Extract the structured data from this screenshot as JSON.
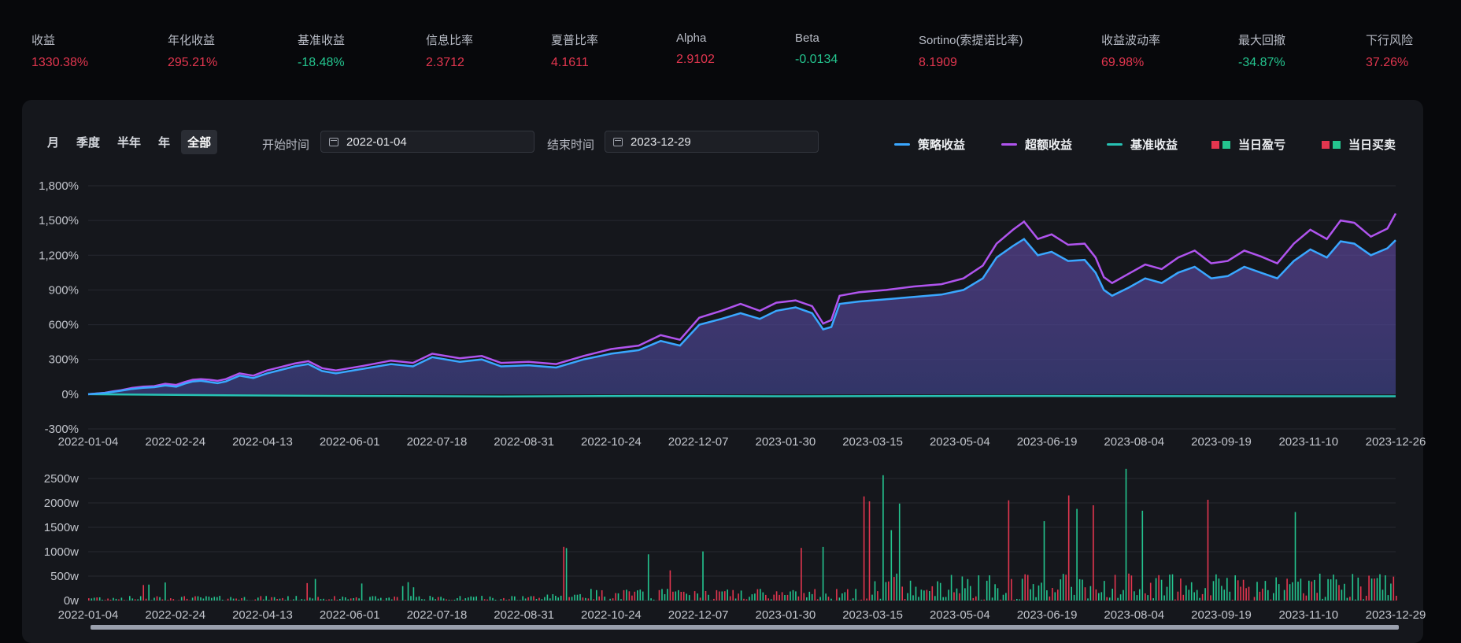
{
  "metrics": [
    {
      "label": "收益",
      "value": "1330.38%",
      "color": "red",
      "left": 40
    },
    {
      "label": "年化收益",
      "value": "295.21%",
      "color": "red",
      "left": 213
    },
    {
      "label": "基准收益",
      "value": "-18.48%",
      "color": "green",
      "left": 378
    },
    {
      "label": "信息比率",
      "value": "2.3712",
      "color": "red",
      "left": 541
    },
    {
      "label": "夏普比率",
      "value": "4.1611",
      "color": "red",
      "left": 700
    },
    {
      "label": "Alpha",
      "value": "2.9102",
      "color": "red",
      "left": 859
    },
    {
      "label": "Beta",
      "value": "-0.0134",
      "color": "green",
      "left": 1010
    },
    {
      "label": "Sortino(索提诺比率)",
      "value": "8.1909",
      "color": "red",
      "left": 1167
    },
    {
      "label": "收益波动率",
      "value": "69.98%",
      "color": "red",
      "left": 1399
    },
    {
      "label": "最大回撤",
      "value": "-34.87%",
      "color": "green",
      "left": 1573
    },
    {
      "label": "下行风险",
      "value": "37.26%",
      "color": "red",
      "left": 1735
    }
  ],
  "periods": [
    "月",
    "季度",
    "半年",
    "年",
    "全部"
  ],
  "active_period": "全部",
  "start": {
    "label": "开始时间",
    "value": "2022-01-04"
  },
  "end": {
    "label": "结束时间",
    "value": "2023-12-29"
  },
  "legend": {
    "strategy": {
      "label": "策略收益",
      "color": "#3aa7ff"
    },
    "excess": {
      "label": "超额收益",
      "color": "#b054ee"
    },
    "benchmark": {
      "label": "基准收益",
      "color": "#27c2b4"
    },
    "daily_pnl": {
      "label": "当日盈亏"
    },
    "daily_trade": {
      "label": "当日买卖"
    }
  },
  "colors": {
    "up": "#e3364f",
    "down": "#24c58f"
  },
  "chart_data": [
    {
      "type": "line",
      "x_ticks": [
        "2022-01-04",
        "2022-02-24",
        "2022-04-13",
        "2022-06-01",
        "2022-07-18",
        "2022-08-31",
        "2022-10-24",
        "2022-12-07",
        "2023-01-30",
        "2023-03-15",
        "2023-05-04",
        "2023-06-19",
        "2023-08-04",
        "2023-09-19",
        "2023-11-10",
        "2023-12-26"
      ],
      "y_ticks": [
        "1,800%",
        "1,500%",
        "1,200%",
        "900%",
        "600%",
        "300%",
        "0%",
        "-300%"
      ],
      "ylim": [
        -300,
        1800
      ],
      "series": [
        {
          "name": "策略收益",
          "points": [
            [
              0,
              0
            ],
            [
              3,
              5
            ],
            [
              6,
              10
            ],
            [
              9,
              20
            ],
            [
              12,
              30
            ],
            [
              16,
              45
            ],
            [
              20,
              55
            ],
            [
              24,
              60
            ],
            [
              28,
              75
            ],
            [
              32,
              65
            ],
            [
              35,
              90
            ],
            [
              38,
              110
            ],
            [
              41,
              115
            ],
            [
              44,
              105
            ],
            [
              47,
              95
            ],
            [
              50,
              110
            ],
            [
              55,
              160
            ],
            [
              60,
              140
            ],
            [
              65,
              180
            ],
            [
              70,
              210
            ],
            [
              75,
              240
            ],
            [
              80,
              260
            ],
            [
              85,
              200
            ],
            [
              90,
              180
            ],
            [
              100,
              220
            ],
            [
              110,
              260
            ],
            [
              118,
              240
            ],
            [
              125,
              320
            ],
            [
              135,
              280
            ],
            [
              143,
              300
            ],
            [
              150,
              240
            ],
            [
              160,
              250
            ],
            [
              170,
              230
            ],
            [
              180,
              300
            ],
            [
              190,
              350
            ],
            [
              200,
              380
            ],
            [
              208,
              460
            ],
            [
              215,
              420
            ],
            [
              222,
              600
            ],
            [
              230,
              650
            ],
            [
              237,
              700
            ],
            [
              244,
              650
            ],
            [
              250,
              720
            ],
            [
              257,
              750
            ],
            [
              263,
              700
            ],
            [
              267,
              560
            ],
            [
              270,
              580
            ],
            [
              273,
              780
            ],
            [
              280,
              800
            ],
            [
              290,
              820
            ],
            [
              300,
              840
            ],
            [
              310,
              860
            ],
            [
              318,
              900
            ],
            [
              325,
              1000
            ],
            [
              330,
              1180
            ],
            [
              336,
              1280
            ],
            [
              340,
              1340
            ],
            [
              345,
              1200
            ],
            [
              350,
              1230
            ],
            [
              356,
              1150
            ],
            [
              362,
              1160
            ],
            [
              366,
              1050
            ],
            [
              369,
              900
            ],
            [
              372,
              850
            ],
            [
              378,
              920
            ],
            [
              384,
              1000
            ],
            [
              390,
              960
            ],
            [
              396,
              1050
            ],
            [
              402,
              1100
            ],
            [
              408,
              1000
            ],
            [
              414,
              1020
            ],
            [
              420,
              1100
            ],
            [
              426,
              1050
            ],
            [
              432,
              1000
            ],
            [
              438,
              1150
            ],
            [
              444,
              1250
            ],
            [
              450,
              1180
            ],
            [
              455,
              1320
            ],
            [
              460,
              1300
            ],
            [
              466,
              1200
            ],
            [
              472,
              1260
            ],
            [
              475,
              1330
            ]
          ]
        },
        {
          "name": "超额收益",
          "points": [
            [
              0,
              0
            ],
            [
              3,
              6
            ],
            [
              6,
              12
            ],
            [
              9,
              25
            ],
            [
              12,
              35
            ],
            [
              16,
              55
            ],
            [
              20,
              65
            ],
            [
              24,
              70
            ],
            [
              28,
              90
            ],
            [
              32,
              80
            ],
            [
              35,
              105
            ],
            [
              38,
              125
            ],
            [
              41,
              130
            ],
            [
              44,
              125
            ],
            [
              47,
              115
            ],
            [
              50,
              130
            ],
            [
              55,
              180
            ],
            [
              60,
              160
            ],
            [
              65,
              205
            ],
            [
              70,
              235
            ],
            [
              75,
              265
            ],
            [
              80,
              285
            ],
            [
              85,
              225
            ],
            [
              90,
              205
            ],
            [
              100,
              245
            ],
            [
              110,
              290
            ],
            [
              118,
              270
            ],
            [
              125,
              350
            ],
            [
              135,
              310
            ],
            [
              143,
              330
            ],
            [
              150,
              270
            ],
            [
              160,
              280
            ],
            [
              170,
              260
            ],
            [
              180,
              330
            ],
            [
              190,
              390
            ],
            [
              200,
              420
            ],
            [
              208,
              510
            ],
            [
              215,
              470
            ],
            [
              222,
              660
            ],
            [
              230,
              720
            ],
            [
              237,
              780
            ],
            [
              244,
              720
            ],
            [
              250,
              790
            ],
            [
              257,
              810
            ],
            [
              263,
              760
            ],
            [
              267,
              610
            ],
            [
              270,
              640
            ],
            [
              273,
              850
            ],
            [
              280,
              880
            ],
            [
              290,
              900
            ],
            [
              300,
              930
            ],
            [
              310,
              950
            ],
            [
              318,
              1000
            ],
            [
              325,
              1110
            ],
            [
              330,
              1300
            ],
            [
              336,
              1420
            ],
            [
              340,
              1490
            ],
            [
              345,
              1340
            ],
            [
              350,
              1380
            ],
            [
              356,
              1290
            ],
            [
              362,
              1300
            ],
            [
              366,
              1180
            ],
            [
              369,
              1010
            ],
            [
              372,
              960
            ],
            [
              378,
              1040
            ],
            [
              384,
              1120
            ],
            [
              390,
              1080
            ],
            [
              396,
              1180
            ],
            [
              402,
              1240
            ],
            [
              408,
              1130
            ],
            [
              414,
              1150
            ],
            [
              420,
              1240
            ],
            [
              426,
              1190
            ],
            [
              432,
              1130
            ],
            [
              438,
              1300
            ],
            [
              444,
              1420
            ],
            [
              450,
              1340
            ],
            [
              455,
              1500
            ],
            [
              460,
              1480
            ],
            [
              466,
              1360
            ],
            [
              472,
              1430
            ],
            [
              475,
              1560
            ]
          ]
        },
        {
          "name": "基准收益",
          "points": [
            [
              0,
              0
            ],
            [
              50,
              -10
            ],
            [
              100,
              -15
            ],
            [
              150,
              -20
            ],
            [
              200,
              -15
            ],
            [
              250,
              -18
            ],
            [
              300,
              -16
            ],
            [
              350,
              -15
            ],
            [
              400,
              -17
            ],
            [
              475,
              -18
            ]
          ]
        }
      ]
    },
    {
      "type": "bar",
      "x_ticks": [
        "2022-01-04",
        "2022-02-24",
        "2022-04-13",
        "2022-06-01",
        "2022-07-18",
        "2022-08-31",
        "2022-10-24",
        "2022-12-07",
        "2023-01-30",
        "2023-03-15",
        "2023-05-04",
        "2023-06-19",
        "2023-08-04",
        "2023-09-19",
        "2023-11-10",
        "2023-12-29"
      ],
      "y_ticks": [
        "2500w",
        "2000w",
        "1500w",
        "1000w",
        "500w",
        "0w"
      ],
      "ylim": [
        0,
        2500
      ],
      "series": [
        {
          "name": "当日买卖"
        }
      ]
    }
  ]
}
